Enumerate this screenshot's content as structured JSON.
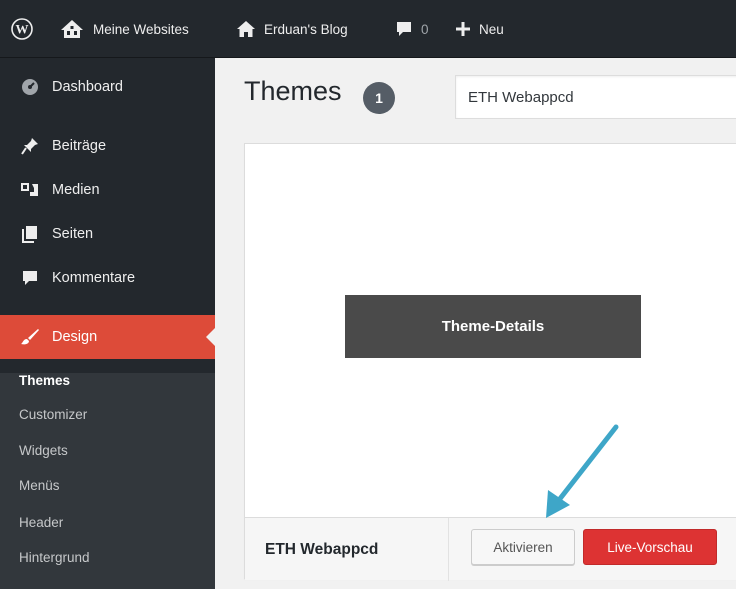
{
  "adminbar": {
    "wp_icon": "wordpress-logo-icon",
    "sites_label": "Meine Websites",
    "blog_label": "Erduan's Blog",
    "comments_count": "0",
    "new_label": "Neu"
  },
  "sidebar": {
    "items": [
      {
        "label": "Dashboard",
        "icon": "dashboard-gauge-icon"
      },
      {
        "label": "Beiträge",
        "icon": "pushpin-icon"
      },
      {
        "label": "Medien",
        "icon": "media-camera-icon"
      },
      {
        "label": "Seiten",
        "icon": "pages-icon"
      },
      {
        "label": "Kommentare",
        "icon": "comment-bubble-icon"
      },
      {
        "label": "Design",
        "icon": "paintbrush-icon",
        "active": true
      }
    ],
    "submenu": [
      {
        "label": "Themes",
        "current": true
      },
      {
        "label": "Customizer"
      },
      {
        "label": "Widgets"
      },
      {
        "label": "Menüs"
      },
      {
        "label": "Header"
      },
      {
        "label": "Hintergrund"
      }
    ]
  },
  "main": {
    "title": "Themes",
    "count": "1",
    "search_value": "ETH Webappcd"
  },
  "theme": {
    "details_label": "Theme-Details",
    "name": "ETH Webappcd",
    "activate_label": "Aktivieren",
    "preview_label": "Live-Vorschau"
  },
  "colors": {
    "adminbar_bg": "#23282d",
    "active_menu": "#dd4b39",
    "preview_button": "#dd3333",
    "annotation_arrow": "#3ea6c8"
  }
}
